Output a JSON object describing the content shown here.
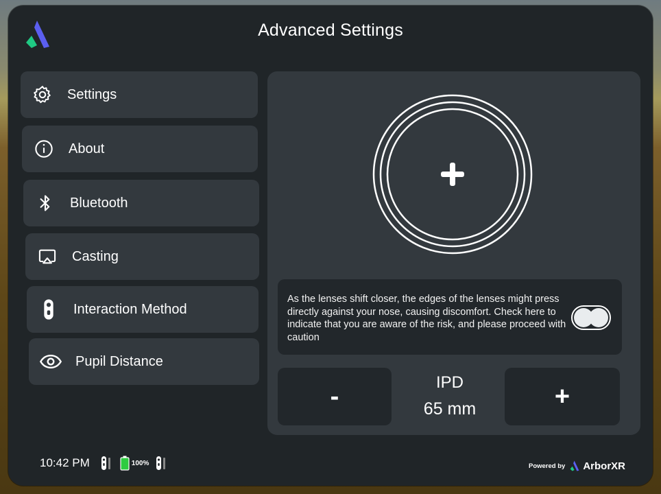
{
  "header": {
    "title": "Advanced Settings"
  },
  "menu": {
    "items": [
      {
        "label": "Settings",
        "icon": "gear-icon"
      },
      {
        "label": "About",
        "icon": "info-icon"
      },
      {
        "label": "Bluetooth",
        "icon": "bluetooth-icon"
      },
      {
        "label": "Casting",
        "icon": "cast-icon"
      },
      {
        "label": "Interaction Method",
        "icon": "controller-icon"
      },
      {
        "label": "Pupil Distance",
        "icon": "eye-icon"
      }
    ]
  },
  "ipd": {
    "warning_text": "As the lenses shift closer, the edges of the lenses might press directly against your nose, causing discomfort. Check here to indicate that you are aware of the risk, and please proceed with caution",
    "minus_label": "-",
    "plus_label": "+",
    "label": "IPD",
    "value": "65 mm",
    "risk_acknowledged": false
  },
  "status_bar": {
    "time": "10:42 PM",
    "battery": "100%",
    "battery_color": "#2ecc40"
  },
  "footer": {
    "powered_by": "Powered by",
    "brand": "ArborXR"
  },
  "colors": {
    "accent_blue": "#4a6cf7",
    "accent_green": "#1fc983"
  }
}
